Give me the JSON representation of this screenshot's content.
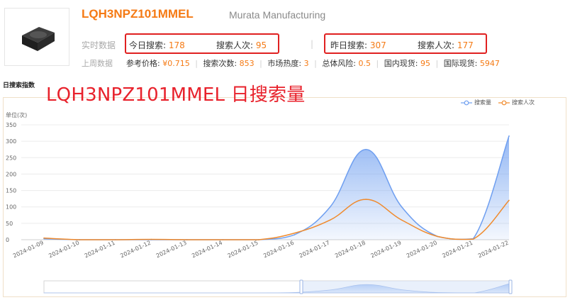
{
  "product": {
    "part_number": "LQH3NPZ101MMEL",
    "manufacturer": "Murata Manufacturing"
  },
  "realtime": {
    "label": "实时数据",
    "today_search_label": "今日搜索:",
    "today_search_value": "178",
    "today_people_label": "搜索人次:",
    "today_people_value": "95",
    "separator": "|",
    "yesterday_search_label": "昨日搜索:",
    "yesterday_search_value": "307",
    "yesterday_people_label": "搜索人次:",
    "yesterday_people_value": "177"
  },
  "lastweek": {
    "label": "上周数据",
    "items": [
      {
        "label": "参考价格:",
        "value": "¥0.715"
      },
      {
        "label": "搜索次数:",
        "value": "853"
      },
      {
        "label": "市场热度:",
        "value": "3"
      },
      {
        "label": "总体风险:",
        "value": "0.5"
      },
      {
        "label": "国内现货:",
        "value": "95"
      },
      {
        "label": "国际现货:",
        "value": "5947"
      }
    ]
  },
  "section_title": "日搜索指数",
  "overlay_title": "LQH3NPZ101MMEL 日搜索量",
  "colors": {
    "accent": "#f57a14",
    "highlight": "#e02020",
    "series_search": "#6f9ff0",
    "series_people": "#f08a2c"
  },
  "chart_data": {
    "type": "area",
    "unit_label": "单位(次)",
    "ylim": [
      0,
      350
    ],
    "yticks": [
      0,
      50,
      100,
      150,
      200,
      250,
      300,
      350
    ],
    "x": [
      "2024-01-09",
      "2024-01-10",
      "2024-01-11",
      "2024-01-12",
      "2024-01-13",
      "2024-01-14",
      "2024-01-15",
      "2024-01-16",
      "2024-01-17",
      "2024-01-18",
      "2024-01-19",
      "2024-01-20",
      "2024-01-21",
      "2024-01-22"
    ],
    "series": [
      {
        "name": "搜索量",
        "values": [
          3,
          0,
          0,
          0,
          0,
          0,
          0,
          15,
          100,
          275,
          100,
          10,
          3,
          316
        ]
      },
      {
        "name": "搜索人次",
        "values": [
          5,
          0,
          0,
          1,
          0,
          0,
          0,
          20,
          60,
          123,
          60,
          10,
          2,
          120
        ]
      }
    ],
    "legend_position": "top-right",
    "grid": true
  }
}
